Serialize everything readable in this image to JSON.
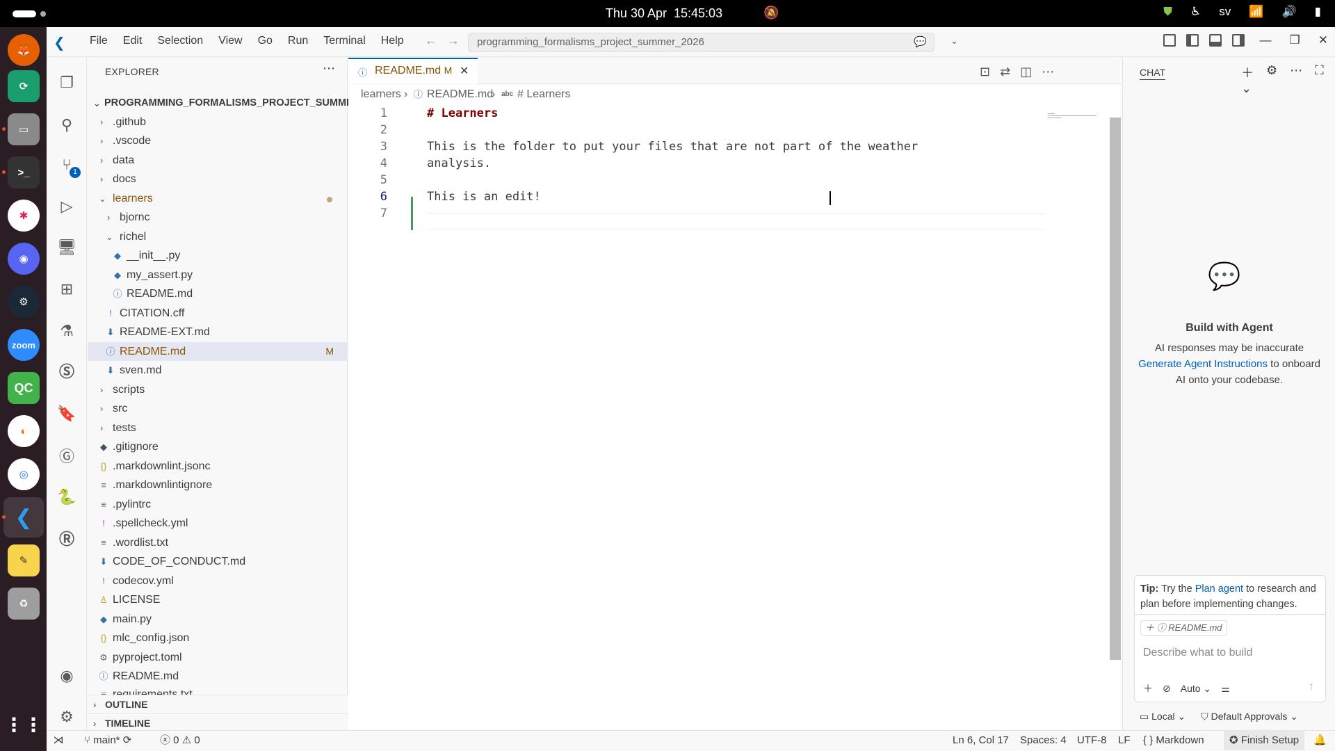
{
  "topbar": {
    "date": "Thu 30 Apr",
    "time": "15:45:03",
    "language": "sv"
  },
  "window": {
    "menu": [
      "File",
      "Edit",
      "Selection",
      "View",
      "Go",
      "Run",
      "Terminal",
      "Help"
    ],
    "command_center": "programming_formalisms_project_summer_2026"
  },
  "sidebar": {
    "title": "EXPLORER",
    "root": "PROGRAMMING_FORMALISMS_PROJECT_SUMMER...",
    "items": [
      {
        "label": ".github",
        "kind": "folder"
      },
      {
        "label": ".vscode",
        "kind": "folder"
      },
      {
        "label": "data",
        "kind": "folder"
      },
      {
        "label": "docs",
        "kind": "folder"
      },
      {
        "label": "learners",
        "kind": "folder-open"
      },
      {
        "label": "bjornc",
        "kind": "folder"
      },
      {
        "label": "richel",
        "kind": "folder-open"
      },
      {
        "label": "__init__.py",
        "kind": "py"
      },
      {
        "label": "my_assert.py",
        "kind": "py"
      },
      {
        "label": "README.md",
        "kind": "info"
      },
      {
        "label": "CITATION.cff",
        "kind": "yml"
      },
      {
        "label": "README-EXT.md",
        "kind": "md"
      },
      {
        "label": "README.md",
        "kind": "info",
        "status": "M"
      },
      {
        "label": "sven.md",
        "kind": "md"
      },
      {
        "label": "scripts",
        "kind": "folder"
      },
      {
        "label": "src",
        "kind": "folder"
      },
      {
        "label": "tests",
        "kind": "folder"
      },
      {
        "label": ".gitignore",
        "kind": "git"
      },
      {
        "label": ".markdownlint.jsonc",
        "kind": "json"
      },
      {
        "label": ".markdownlintignore",
        "kind": "txt"
      },
      {
        "label": ".pylintrc",
        "kind": "txt"
      },
      {
        "label": ".spellcheck.yml",
        "kind": "yml"
      },
      {
        "label": ".wordlist.txt",
        "kind": "txt"
      },
      {
        "label": "CODE_OF_CONDUCT.md",
        "kind": "md"
      },
      {
        "label": "codecov.yml",
        "kind": "yml"
      },
      {
        "label": "LICENSE",
        "kind": "lic"
      },
      {
        "label": "main.py",
        "kind": "py"
      },
      {
        "label": "mlc_config.json",
        "kind": "json"
      },
      {
        "label": "pyproject.toml",
        "kind": "cfg"
      },
      {
        "label": "README.md",
        "kind": "info"
      },
      {
        "label": "requirements.txt",
        "kind": "txt"
      }
    ],
    "outline": "OUTLINE",
    "timeline": "TIMELINE"
  },
  "editor": {
    "tab_name": "README.md",
    "tab_status": "M",
    "breadcrumb": [
      "learners",
      "README.md",
      "# Learners"
    ],
    "lines": [
      {
        "n": "1",
        "text": "# Learners"
      },
      {
        "n": "2",
        "text": ""
      },
      {
        "n": "3",
        "text": "This is the folder to put your files that are not part of the weather"
      },
      {
        "n": "4",
        "text": "analysis."
      },
      {
        "n": "5",
        "text": ""
      },
      {
        "n": "6",
        "text": "This is an edit!"
      },
      {
        "n": "7",
        "text": ""
      }
    ]
  },
  "chat": {
    "title": "CHAT",
    "heading": "Build with Agent",
    "desc_line1": "AI responses may be inaccurate",
    "desc_link": "Generate Agent Instructions",
    "desc_rest": " to onboard AI onto your codebase.",
    "tip_prefix": "Tip:",
    "tip_mid1": " Try the ",
    "tip_link": "Plan agent",
    "tip_mid2": " to research and plan before implementing changes.",
    "context_chip": "README.md",
    "placeholder": "Describe what to build",
    "mode": "Auto",
    "footer_local": "Local",
    "footer_approvals": "Default Approvals"
  },
  "status": {
    "branch": "main*",
    "errors": "0",
    "warnings": "0",
    "position": "Ln 6, Col 17",
    "spaces": "Spaces: 4",
    "encoding": "UTF-8",
    "eol": "LF",
    "language": "Markdown",
    "finish": "Finish Setup"
  },
  "scm_badge": "1",
  "dock": {
    "zoom_label": "zoom",
    "qc_label": "QC"
  }
}
